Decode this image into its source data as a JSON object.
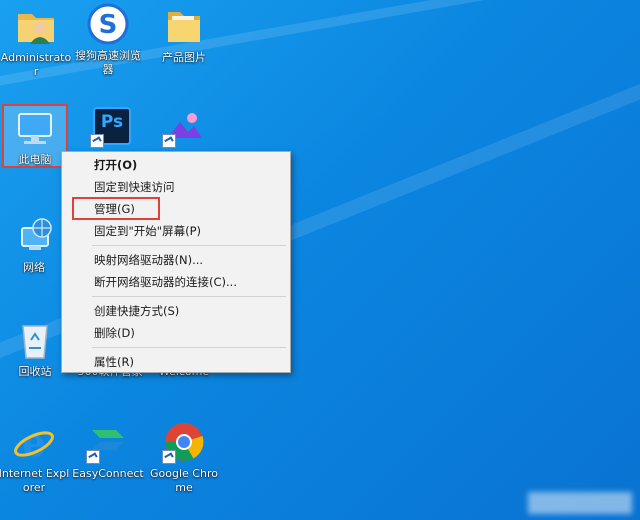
{
  "desktop": {
    "icons": {
      "administrator": {
        "label": "Administrator"
      },
      "sogou": {
        "label": "搜狗高速浏览器"
      },
      "product_images": {
        "label": "产品图片"
      },
      "this_pc": {
        "label": "此电脑"
      },
      "photoshop": {
        "label": "Ps"
      },
      "network": {
        "label": "网络"
      },
      "recycle_bin": {
        "label": "回收站"
      },
      "partial_1": {
        "label": "360软件管家"
      },
      "partial_2": {
        "label": "Welcome"
      },
      "ie": {
        "label": "Internet Explorer"
      },
      "easyconnect": {
        "label": "EasyConnect"
      },
      "chrome": {
        "label": "Google Chrome"
      }
    }
  },
  "context_menu": {
    "items": [
      {
        "label": "打开(O)"
      },
      {
        "label": "固定到快速访问"
      },
      {
        "label": "管理(G)"
      },
      {
        "label": "固定到\"开始\"屏幕(P)"
      },
      {
        "label": "映射网络驱动器(N)..."
      },
      {
        "label": "断开网络驱动器的连接(C)..."
      },
      {
        "label": "创建快捷方式(S)"
      },
      {
        "label": "删除(D)"
      },
      {
        "label": "属性(R)"
      }
    ]
  },
  "colors": {
    "desktop_bg": "#0b86e0",
    "annotation_red": "#e0413a",
    "menu_bg": "#f2f2f2"
  }
}
